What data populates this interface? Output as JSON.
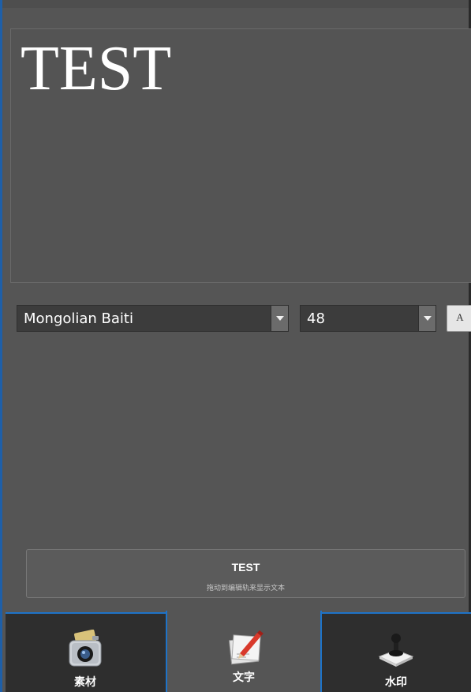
{
  "preview": {
    "text": "TEST"
  },
  "font_select": {
    "value": "Mongolian Baiti",
    "icon": "chevron-down-icon"
  },
  "size_select": {
    "value": "48",
    "icon": "chevron-down-icon"
  },
  "text_style_button": {
    "glyph": "A",
    "icon": "text-style-icon"
  },
  "text_card": {
    "title": "TEST",
    "hint": "拖动到编辑轨来显示文本"
  },
  "tabs": [
    {
      "label": "素材",
      "icon": "camera-assets-icon"
    },
    {
      "label": "文字",
      "icon": "pencil-paper-icon",
      "active": true
    },
    {
      "label": "水印",
      "icon": "joystick-stamp-icon"
    }
  ],
  "colors": {
    "panel": "#555555",
    "accent": "#1e73c8",
    "bottom_bar": "#2e2e2e"
  }
}
